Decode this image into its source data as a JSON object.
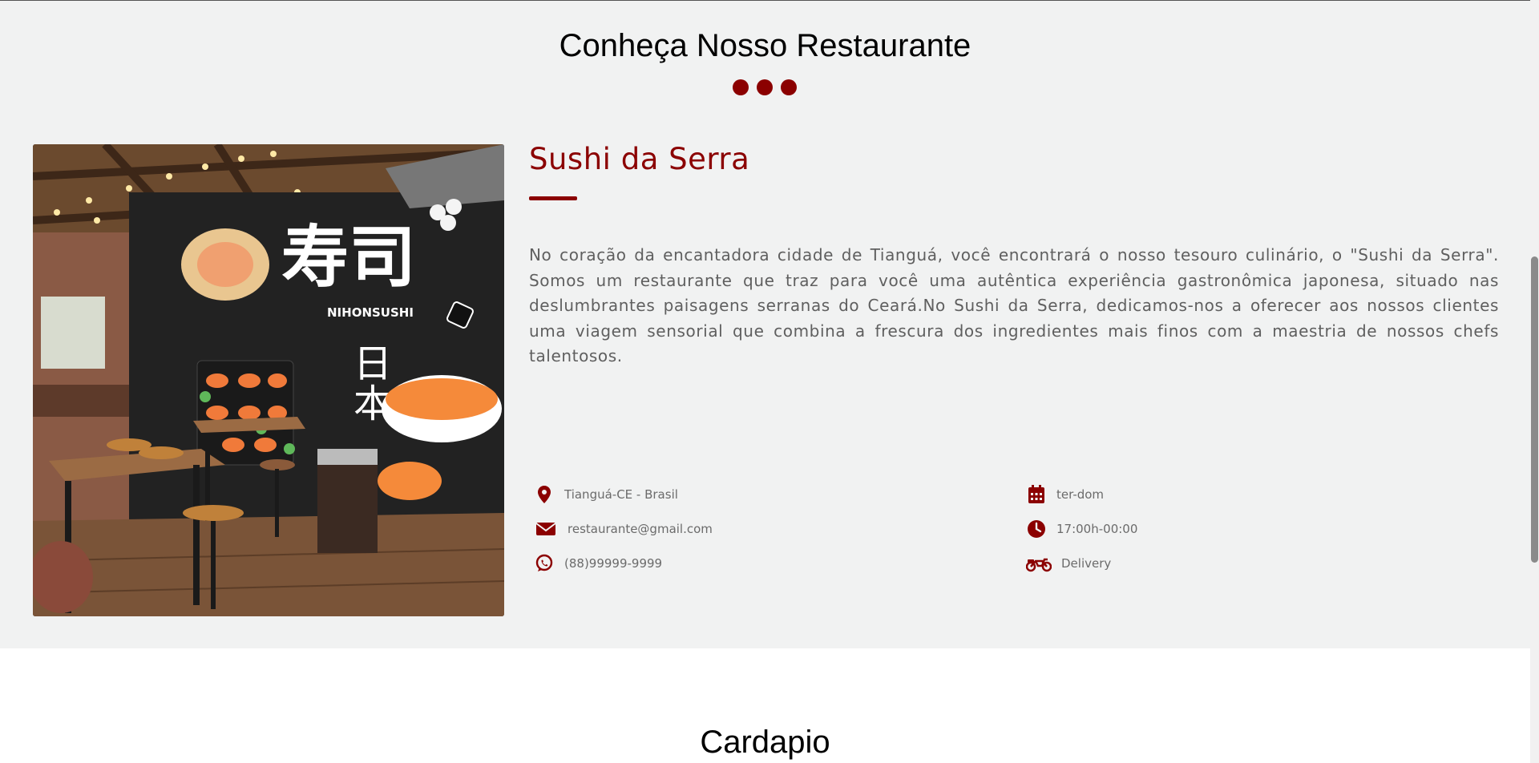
{
  "about": {
    "title": "Conheça Nosso Restaurante",
    "restaurant_name": "Sushi da Serra",
    "description": "No coração da encantadora cidade de Tianguá, você encontrará o nosso tesouro culinário, o \"Sushi da Serra\". Somos um restaurante que traz para você uma autêntica experiência gastronômica japonesa, situado nas deslumbrantes paisagens serranas do Ceará.No Sushi da Serra, dedicamos-nos a oferecer aos nossos clientes uma viagem sensorial que combina a frescura dos ingredientes mais finos com a maestria de nossos chefs talentosos.",
    "image": {
      "alt": "restaurant-interior-photo",
      "sign_text": "NIHONSUSHI"
    },
    "info": [
      {
        "icon": "location-pin-icon",
        "text": "Tianguá-CE - Brasil"
      },
      {
        "icon": "envelope-icon",
        "text": "restaurante@gmail.com"
      },
      {
        "icon": "whatsapp-icon",
        "text": "(88)99999-9999"
      },
      {
        "icon": "calendar-icon",
        "text": "ter-dom"
      },
      {
        "icon": "clock-icon",
        "text": "17:00h-00:00"
      },
      {
        "icon": "motorcycle-icon",
        "text": "Delivery"
      }
    ]
  },
  "menu": {
    "title": "Cardapio"
  },
  "colors": {
    "accent": "#8b0000",
    "section_bg": "#f1f2f2",
    "text": "#5f5f5f"
  }
}
